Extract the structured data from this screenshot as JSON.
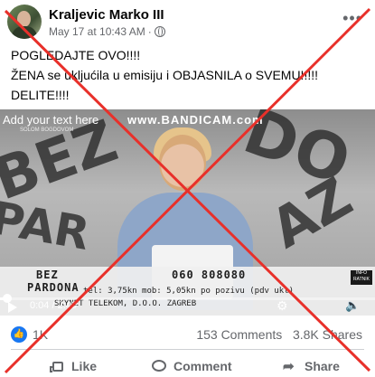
{
  "post": {
    "author": "Kraljevic Marko III",
    "date": "May 17 at 10:43 AM",
    "separator": "·",
    "more_icon": "more-horizontal-icon",
    "caption_lines": [
      "POGLEDAJTE OVO!!!!",
      "ŽENA se ukljućila u emisiju i OBJASNILA o SVEMU!!!!!",
      "DELITE!!!!"
    ]
  },
  "video": {
    "watermark_left": "Add your text here",
    "watermark_brand": "www.BANDICAM.com",
    "subtag": "SOLOM BOGDOVOM",
    "banner_title_1": "BEZ",
    "banner_title_2": "PARDONA",
    "phone": "060 808080",
    "price_line": "tel: 3,75kn  mob: 5,05kn  po pozivu (pdv ukl)",
    "operator_line": "SKYNET TELEKOM, D.O.O. ZAGREB",
    "info_logo": "INFO RATNIK",
    "time": "0:04 / 2:40",
    "progress_fraction": 0.02
  },
  "stats": {
    "reaction_count": "1K",
    "comments": "153 Comments",
    "shares": "3.8K Shares"
  },
  "actions": {
    "like": "Like",
    "comment": "Comment",
    "share": "Share"
  },
  "colors": {
    "overlay_cross": "#e8302a",
    "facebook_blue": "#1877f2",
    "secondary_text": "#65676b"
  }
}
